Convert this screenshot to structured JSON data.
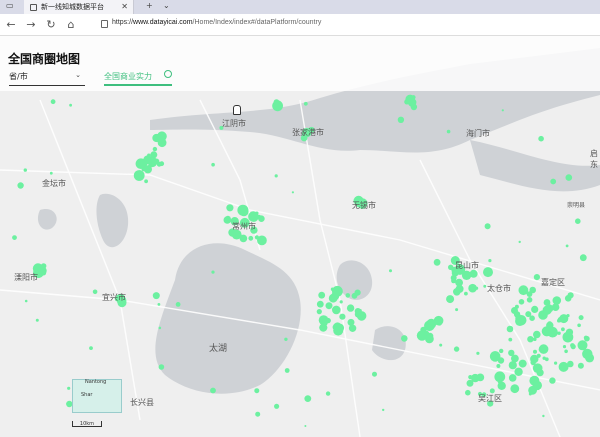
{
  "browser": {
    "tab_title": "新一线知城数据平台",
    "url_scheme": "https://",
    "url_host": "www.datayicai.com",
    "url_path": "/Home/Index/index#/dataPlatform/country"
  },
  "page": {
    "title": "全国商圈地图",
    "region_select": "省/市",
    "toggle_label": "全国商业实力"
  },
  "map": {
    "places": [
      {
        "name": "江阴市"
      },
      {
        "name": "张家港市"
      },
      {
        "name": "海门市"
      },
      {
        "name": "金坛市"
      },
      {
        "name": "常州市"
      },
      {
        "name": "溧阳市"
      },
      {
        "name": "宜兴市"
      },
      {
        "name": "无锡市"
      },
      {
        "name": "太湖"
      },
      {
        "name": "昆山市"
      },
      {
        "name": "太仓市"
      },
      {
        "name": "长兴县"
      },
      {
        "name": "吴江区"
      },
      {
        "name": "嘉定区"
      },
      {
        "name": "崇明县"
      },
      {
        "name": "启东"
      }
    ],
    "inset_label_1": "Nantong",
    "inset_label_2": "Shar",
    "scale_label": "10km",
    "marker_color": "#6cf0a0"
  }
}
